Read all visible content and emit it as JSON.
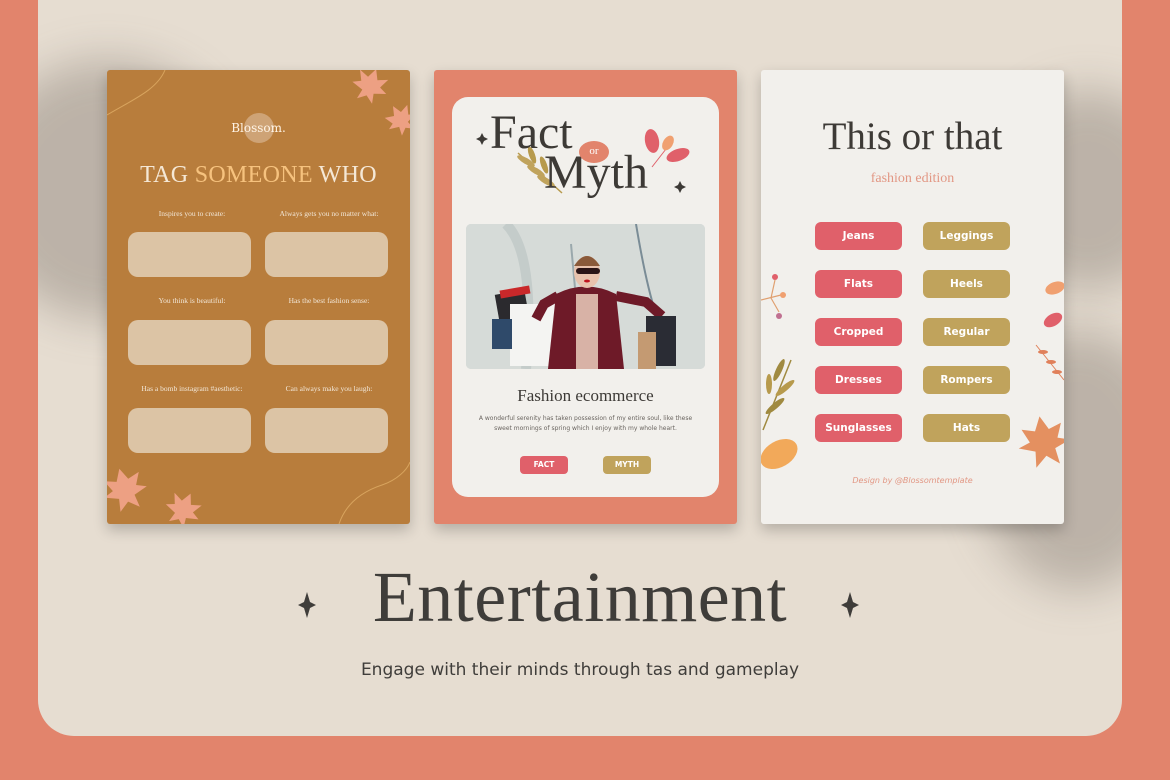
{
  "colors": {
    "outer_background": "#e2846c",
    "panel_background": "#e6ddd1",
    "card1_background": "#b87d3c",
    "card2_frame": "#e2846c",
    "card_inner": "#f2f0ec",
    "pink_button": "#e0606a",
    "gold_button": "#c0a35c",
    "accent_text": "#f6c27e",
    "dark_text": "#3f3d3a"
  },
  "card_tag": {
    "logo": "Blossom.",
    "title_prefix": "TAG ",
    "title_accent": "SOMEONE",
    "title_suffix": " WHO",
    "prompts": [
      "Inspires you to create:",
      "Always gets you no matter what:",
      "You think is beautiful:",
      "Has the best fashion sense:",
      "Has a bomb instagram #aesthetic:",
      "Can always make you laugh:"
    ]
  },
  "card_fact_myth": {
    "word_fact": "Fact",
    "word_or": "or",
    "word_myth": "Myth",
    "photo_alt": "woman-with-shopping-bags-photo",
    "heading": "Fashion ecommerce",
    "body": "A wonderful serenity has taken possession of my entire soul, like these sweet mornings of spring which I enjoy with my whole heart.",
    "fact_button": "FACT",
    "myth_button": "MYTH"
  },
  "card_this_or_that": {
    "title": "This or that",
    "subtitle": "fashion edition",
    "pairs": [
      {
        "this": "Jeans",
        "that": "Leggings"
      },
      {
        "this": "Flats",
        "that": "Heels"
      },
      {
        "this": "Cropped",
        "that": "Regular"
      },
      {
        "this": "Dresses",
        "that": "Rompers"
      },
      {
        "this": "Sunglasses",
        "that": "Hats"
      }
    ],
    "credit": "Design by @Blossomtemplate"
  },
  "footer": {
    "title": "Entertainment",
    "subtitle": "Engage with their minds through tas and gameplay"
  }
}
